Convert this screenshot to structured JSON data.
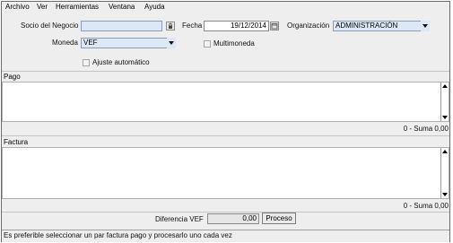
{
  "menu": [
    "Archivo",
    "Ver",
    "Herramientas",
    "Ventana",
    "Ayuda"
  ],
  "form": {
    "socio_label": "Socio del Negocio",
    "socio_value": "",
    "fecha_label": "Fecha",
    "fecha_value": "19/12/2014",
    "org_label": "Organización",
    "org_value": "ADMINISTRACIÓN",
    "moneda_label": "Moneda",
    "moneda_value": "VEF",
    "multimoneda_label": "Multimoneda",
    "multimoneda_checked": false,
    "ajuste_label": "Ajuste automático",
    "ajuste_checked": false
  },
  "pago": {
    "title": "Pago",
    "suma": "0 - Suma  0,00"
  },
  "factura": {
    "title": "Factura",
    "suma": "0 - Suma  0,00"
  },
  "footer": {
    "diferencia_label": "Diferencia VEF",
    "diferencia_value": "0,00",
    "proceso_button": "Proceso"
  },
  "status": "Es preferible seleccionar un par factura pago y procesarlo uno cada vez",
  "icons": {
    "socio_button": "lock-icon",
    "fecha_button": "calendar-icon",
    "dropdown": "chevron-down-icon"
  }
}
